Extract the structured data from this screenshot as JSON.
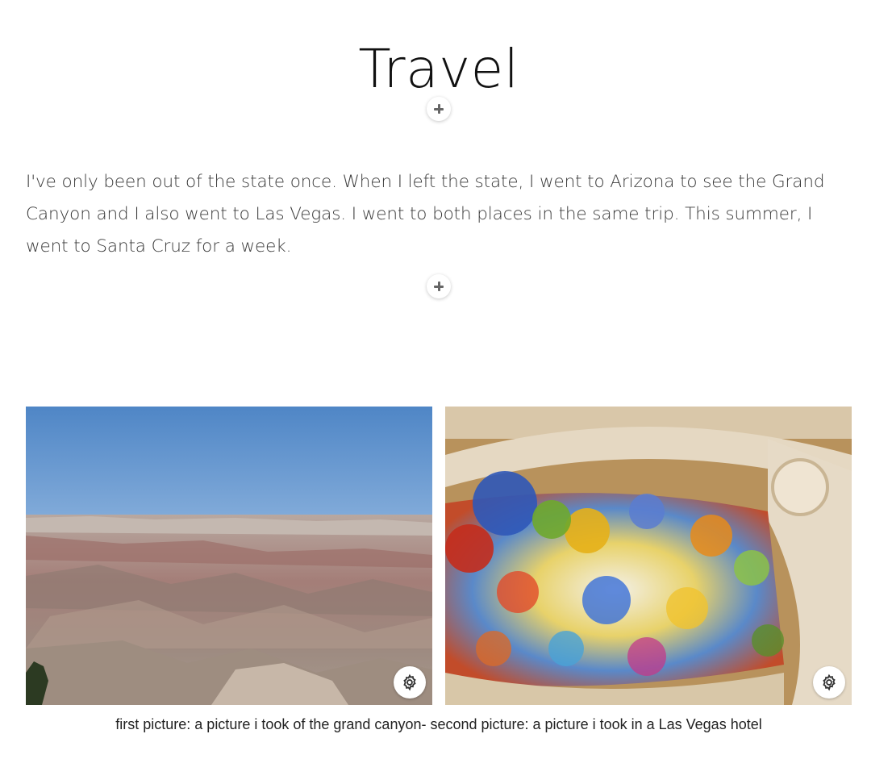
{
  "page": {
    "title": "Travel",
    "paragraph": "I've only been out of the state once. When I left the state, I went to Arizona to see the Grand Canyon and I also went to Las Vegas. I went to both places in the same trip. This summer, I went to Santa Cruz for a week.",
    "caption": "first picture: a picture i took of the grand canyon- second picture: a picture i took in a Las Vegas hotel"
  },
  "controls": {
    "add_icon": "plus-icon",
    "settings_icon": "gear-icon"
  },
  "gallery": {
    "images": [
      {
        "subject": "grand-canyon",
        "settings_icon": "gear-icon"
      },
      {
        "subject": "las-vegas-hotel-glass-ceiling",
        "settings_icon": "gear-icon"
      }
    ]
  },
  "colors": {
    "text": "#3a3a3a",
    "title": "#111111",
    "button_bg": "#ffffff",
    "icon": "#333333"
  }
}
